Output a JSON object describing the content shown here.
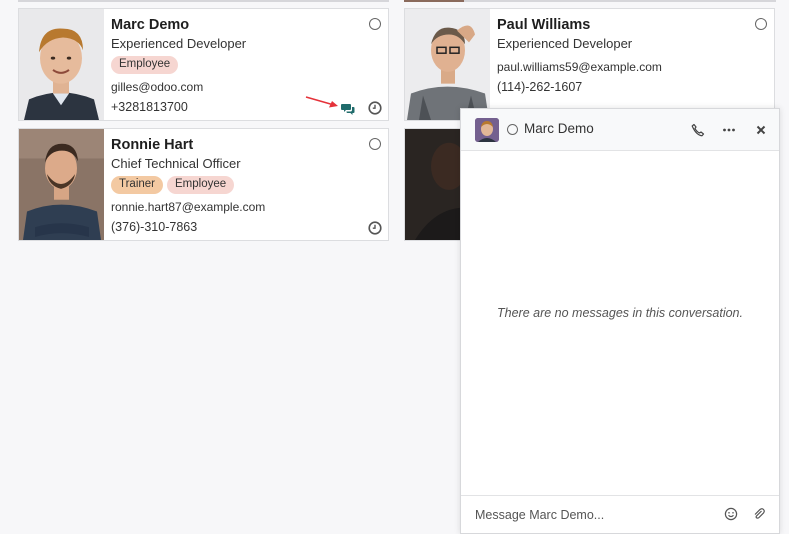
{
  "employees": [
    {
      "name": "Marc Demo",
      "job": "Experienced Developer",
      "tags": [
        "Employee"
      ],
      "email": "gilles@odoo.com",
      "phone": "+3281813700"
    },
    {
      "name": "Paul Williams",
      "job": "Experienced Developer",
      "tags": [],
      "email": "paul.williams59@example.com",
      "phone": "(114)-262-1607"
    },
    {
      "name": "Ronnie Hart",
      "job": "Chief Technical Officer",
      "tags": [
        "Trainer",
        "Employee"
      ],
      "email": "ronnie.hart87@example.com",
      "phone": "(376)-310-7863"
    }
  ],
  "chat": {
    "title": "Marc Demo",
    "empty_message": "There are no messages in this conversation.",
    "composer_placeholder": "Message Marc Demo..."
  },
  "icons": {
    "chat": "chat-bubbles-icon",
    "clock": "clock-icon",
    "phone": "phone-icon",
    "more": "ellipsis-icon",
    "close": "close-icon",
    "emoji": "smiley-icon",
    "attach": "paperclip-icon"
  },
  "colors": {
    "employee_tag": "#f6d6d1",
    "trainer_tag": "#f3c9a2",
    "chat_icon": "#1f6b6b",
    "arrow": "#e5323a"
  }
}
